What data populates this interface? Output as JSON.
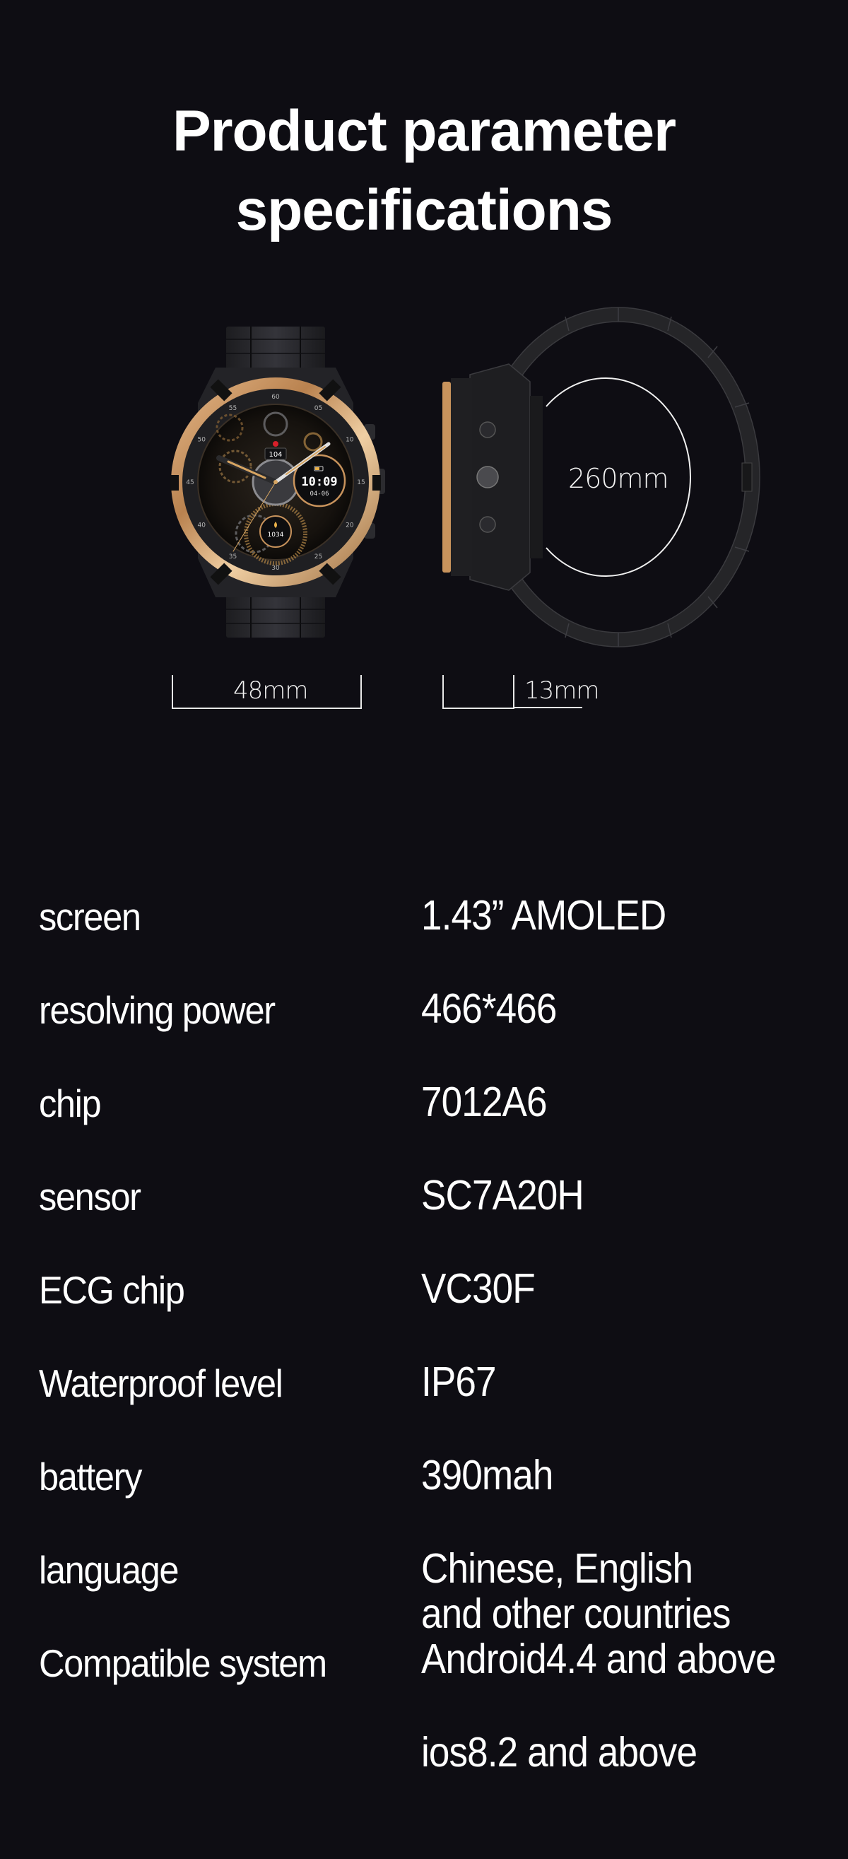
{
  "header": {
    "title_line1": "Product parameter",
    "title_line2": "specifications"
  },
  "watch_front": {
    "face": {
      "heart_rate": "104",
      "time": "10:09",
      "date": "04-06",
      "calories": "1034",
      "bezel_numbers": [
        "60",
        "05",
        "10",
        "15",
        "20",
        "25",
        "30",
        "35",
        "40",
        "45",
        "50",
        "55"
      ]
    },
    "width_label": "48mm"
  },
  "watch_side": {
    "circumference_label": "260mm",
    "thickness_label": "13mm"
  },
  "colors": {
    "background": "#0e0d13",
    "gold": "#c8935c",
    "text": "#ffffff"
  },
  "specs": [
    {
      "label": "screen",
      "value": "1.43”  AMOLED"
    },
    {
      "label": "resolving power",
      "value": "466*466"
    },
    {
      "label": "chip",
      "value": "7012A6"
    },
    {
      "label": "sensor",
      "value": "SC7A20H"
    },
    {
      "label": "ECG chip",
      "value": "VC30F"
    },
    {
      "label": "Waterproof level",
      "value": "IP67"
    },
    {
      "label": "battery",
      "value": "390mah"
    },
    {
      "label": "language",
      "value_lines": [
        "Chinese, English",
        "and other countries"
      ]
    },
    {
      "label": "Compatible system",
      "value_lines": [
        "Android4.4 and above",
        "ios8.2 and above"
      ]
    }
  ]
}
